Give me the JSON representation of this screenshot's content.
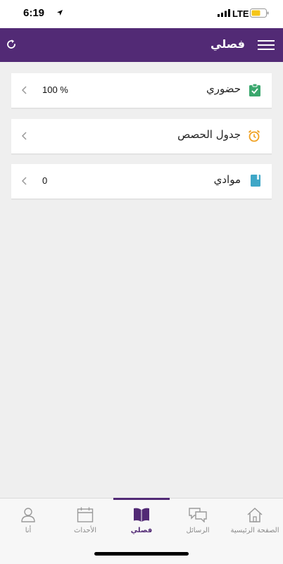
{
  "status_bar": {
    "time": "6:19",
    "network": "LTE",
    "battery_color": "#f5c518"
  },
  "app_bar": {
    "title": "فصلي",
    "background": "#522a75",
    "left_icon": "refresh-icon",
    "right_icon": "menu-icon"
  },
  "cards": [
    {
      "label": "حضوري",
      "value": "100 %",
      "icon": "clipboard-check-icon",
      "icon_color": "#3aa76d"
    },
    {
      "label": "جدول الحصص",
      "value": "",
      "icon": "alarm-clock-icon",
      "icon_color": "#f0a020"
    },
    {
      "label": "موادي",
      "value": "0",
      "icon": "book-icon",
      "icon_color": "#3fa7c7"
    }
  ],
  "bottom_nav": {
    "items": [
      {
        "label": "الصفحة الرئيسية",
        "icon": "home-icon"
      },
      {
        "label": "الرسائل",
        "icon": "chat-icon"
      },
      {
        "label": "فصلي",
        "icon": "book-open-icon",
        "active": true
      },
      {
        "label": "الأحداث",
        "icon": "calendar-icon"
      },
      {
        "label": "أنا",
        "icon": "user-icon"
      }
    ],
    "active_color": "#522a75"
  }
}
